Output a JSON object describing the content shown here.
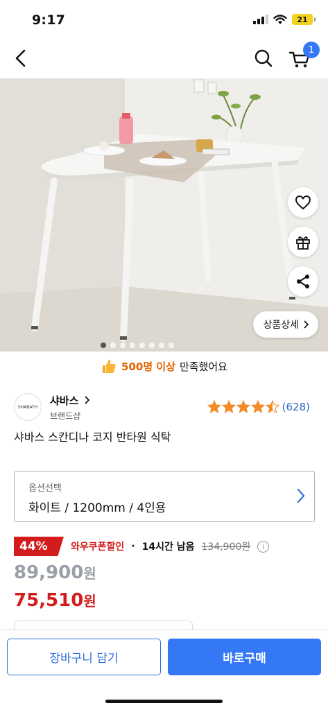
{
  "status_bar": {
    "time": "9:17",
    "battery": "21",
    "icons": [
      "signal-icon",
      "wifi-icon",
      "battery-icon"
    ]
  },
  "nav": {
    "cart_badge": "1",
    "icons": [
      "back-arrow-icon",
      "search-icon",
      "cart-icon"
    ]
  },
  "hero": {
    "carousel_total": 8,
    "carousel_active": 1,
    "detail_button_label": "상품상세",
    "float_buttons": [
      "heart-icon",
      "gift-icon",
      "share-icon"
    ]
  },
  "satisfaction": {
    "count_text": "500명 이상",
    "suffix_text": "만족했어요"
  },
  "brand": {
    "logo_text": "SHABATH",
    "name": "샤바스",
    "subtitle": "브랜드샵"
  },
  "rating": {
    "stars": 4.5,
    "count": "(628)"
  },
  "product": {
    "title": "샤바스 스칸디나 코지 반타원 식탁"
  },
  "option": {
    "label": "옵션선택",
    "value": "화이트 / 1200mm / 4인용"
  },
  "price": {
    "discount": "44%",
    "coupon_label": "와우쿠폰할인",
    "separator": "·",
    "timer": "14시간 남음",
    "strike_price": "134,900원",
    "original": "89,900",
    "final": "75,510",
    "currency": "원"
  },
  "bottom": {
    "cart_button": "장바구니 담기",
    "buy_button": "바로구매"
  },
  "colors": {
    "accent_blue": "#3478f6",
    "sale_red": "#d31d1d",
    "star_orange": "#f28c28",
    "satisfaction_orange": "#e06300"
  }
}
